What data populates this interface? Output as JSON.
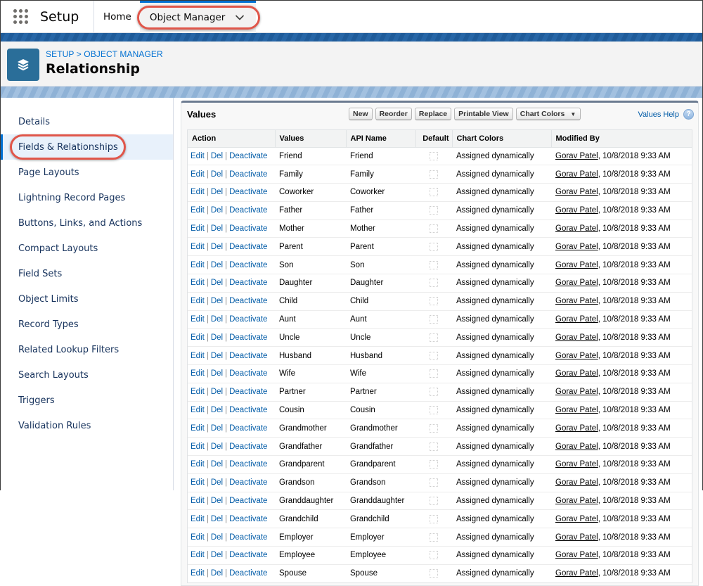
{
  "topnav": {
    "app_launcher_icon": "app-launcher-grid-icon",
    "app_name": "Setup",
    "tabs": [
      {
        "label": "Home"
      },
      {
        "label": "Object Manager",
        "icon": "chevron-down-icon",
        "active": true
      }
    ]
  },
  "header": {
    "icon": "layers-icon",
    "breadcrumb": "SETUP > OBJECT MANAGER",
    "title": "Relationship",
    "icon_color": "#2a6e99"
  },
  "sidebar": {
    "items": [
      {
        "label": "Details"
      },
      {
        "label": "Fields & Relationships",
        "active": true
      },
      {
        "label": "Page Layouts"
      },
      {
        "label": "Lightning Record Pages"
      },
      {
        "label": "Buttons, Links, and Actions"
      },
      {
        "label": "Compact Layouts"
      },
      {
        "label": "Field Sets"
      },
      {
        "label": "Object Limits"
      },
      {
        "label": "Record Types"
      },
      {
        "label": "Related Lookup Filters"
      },
      {
        "label": "Search Layouts"
      },
      {
        "label": "Triggers"
      },
      {
        "label": "Validation Rules"
      }
    ]
  },
  "values_panel": {
    "title": "Values",
    "buttons": {
      "new": "New",
      "reorder": "Reorder",
      "replace": "Replace",
      "printable_view": "Printable View",
      "chart_colors": "Chart Colors",
      "chart_colors_arrow": "▼"
    },
    "help_link": "Values Help",
    "help_icon": "?",
    "columns": [
      "Action",
      "Values",
      "API Name",
      "Default",
      "Chart Colors",
      "Modified By"
    ],
    "action_links": {
      "edit": "Edit",
      "del": "Del",
      "deactivate": "Deactivate",
      "sep": "|"
    },
    "rows": [
      {
        "value": "Friend",
        "api": "Friend",
        "default": false,
        "chart": "Assigned dynamically",
        "user": "Gorav Patel",
        "date": ", 10/8/2018 9:33 AM"
      },
      {
        "value": "Family",
        "api": "Family",
        "default": false,
        "chart": "Assigned dynamically",
        "user": "Gorav Patel",
        "date": ", 10/8/2018 9:33 AM"
      },
      {
        "value": "Coworker",
        "api": "Coworker",
        "default": false,
        "chart": "Assigned dynamically",
        "user": "Gorav Patel",
        "date": ", 10/8/2018 9:33 AM"
      },
      {
        "value": "Father",
        "api": "Father",
        "default": false,
        "chart": "Assigned dynamically",
        "user": "Gorav Patel",
        "date": ", 10/8/2018 9:33 AM"
      },
      {
        "value": "Mother",
        "api": "Mother",
        "default": false,
        "chart": "Assigned dynamically",
        "user": "Gorav Patel",
        "date": ", 10/8/2018 9:33 AM"
      },
      {
        "value": "Parent",
        "api": "Parent",
        "default": false,
        "chart": "Assigned dynamically",
        "user": "Gorav Patel",
        "date": ", 10/8/2018 9:33 AM"
      },
      {
        "value": "Son",
        "api": "Son",
        "default": false,
        "chart": "Assigned dynamically",
        "user": "Gorav Patel",
        "date": ", 10/8/2018 9:33 AM"
      },
      {
        "value": "Daughter",
        "api": "Daughter",
        "default": false,
        "chart": "Assigned dynamically",
        "user": "Gorav Patel",
        "date": ", 10/8/2018 9:33 AM"
      },
      {
        "value": "Child",
        "api": "Child",
        "default": false,
        "chart": "Assigned dynamically",
        "user": "Gorav Patel",
        "date": ", 10/8/2018 9:33 AM"
      },
      {
        "value": "Aunt",
        "api": "Aunt",
        "default": false,
        "chart": "Assigned dynamically",
        "user": "Gorav Patel",
        "date": ", 10/8/2018 9:33 AM"
      },
      {
        "value": "Uncle",
        "api": "Uncle",
        "default": false,
        "chart": "Assigned dynamically",
        "user": "Gorav Patel",
        "date": ", 10/8/2018 9:33 AM"
      },
      {
        "value": "Husband",
        "api": "Husband",
        "default": false,
        "chart": "Assigned dynamically",
        "user": "Gorav Patel",
        "date": ", 10/8/2018 9:33 AM"
      },
      {
        "value": "Wife",
        "api": "Wife",
        "default": false,
        "chart": "Assigned dynamically",
        "user": "Gorav Patel",
        "date": ", 10/8/2018 9:33 AM"
      },
      {
        "value": "Partner",
        "api": "Partner",
        "default": false,
        "chart": "Assigned dynamically",
        "user": "Gorav Patel",
        "date": ", 10/8/2018 9:33 AM"
      },
      {
        "value": "Cousin",
        "api": "Cousin",
        "default": false,
        "chart": "Assigned dynamically",
        "user": "Gorav Patel",
        "date": ", 10/8/2018 9:33 AM"
      },
      {
        "value": "Grandmother",
        "api": "Grandmother",
        "default": false,
        "chart": "Assigned dynamically",
        "user": "Gorav Patel",
        "date": ", 10/8/2018 9:33 AM"
      },
      {
        "value": "Grandfather",
        "api": "Grandfather",
        "default": false,
        "chart": "Assigned dynamically",
        "user": "Gorav Patel",
        "date": ", 10/8/2018 9:33 AM"
      },
      {
        "value": "Grandparent",
        "api": "Grandparent",
        "default": false,
        "chart": "Assigned dynamically",
        "user": "Gorav Patel",
        "date": ", 10/8/2018 9:33 AM"
      },
      {
        "value": "Grandson",
        "api": "Grandson",
        "default": false,
        "chart": "Assigned dynamically",
        "user": "Gorav Patel",
        "date": ", 10/8/2018 9:33 AM"
      },
      {
        "value": "Granddaughter",
        "api": "Granddaughter",
        "default": false,
        "chart": "Assigned dynamically",
        "user": "Gorav Patel",
        "date": ", 10/8/2018 9:33 AM"
      },
      {
        "value": "Grandchild",
        "api": "Grandchild",
        "default": false,
        "chart": "Assigned dynamically",
        "user": "Gorav Patel",
        "date": ", 10/8/2018 9:33 AM"
      },
      {
        "value": "Employer",
        "api": "Employer",
        "default": false,
        "chart": "Assigned dynamically",
        "user": "Gorav Patel",
        "date": ", 10/8/2018 9:33 AM"
      },
      {
        "value": "Employee",
        "api": "Employee",
        "default": false,
        "chart": "Assigned dynamically",
        "user": "Gorav Patel",
        "date": ", 10/8/2018 9:33 AM"
      },
      {
        "value": "Spouse",
        "api": "Spouse",
        "default": false,
        "chart": "Assigned dynamically",
        "user": "Gorav Patel",
        "date": ", 10/8/2018 9:33 AM"
      }
    ]
  },
  "colors": {
    "link": "#015ba7",
    "brand_blue": "#0070d2",
    "highlight_ring": "#e0564a",
    "active_sidebar_bg": "#e8f1fb"
  }
}
